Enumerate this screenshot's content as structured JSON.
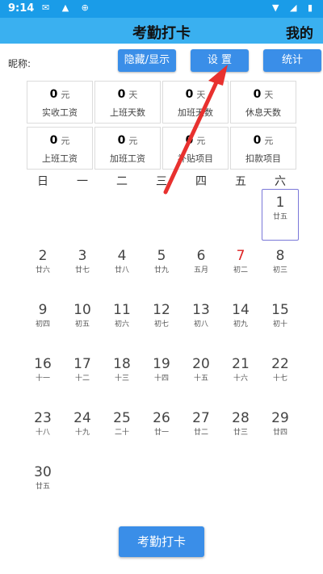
{
  "status": {
    "time": "9:14"
  },
  "header": {
    "title": "考勤打卡",
    "mine": "我的"
  },
  "nickname_label": "昵称:",
  "buttons": {
    "hide_show": "隐藏/显示",
    "settings": "设 置",
    "stats": "统计"
  },
  "stats": [
    {
      "value": "0",
      "unit": "元",
      "label": "实收工资"
    },
    {
      "value": "0",
      "unit": "天",
      "label": "上班天数"
    },
    {
      "value": "0",
      "unit": "天",
      "label": "加班天数"
    },
    {
      "value": "0",
      "unit": "天",
      "label": "休息天数"
    },
    {
      "value": "0",
      "unit": "元",
      "label": "上班工资"
    },
    {
      "value": "0",
      "unit": "元",
      "label": "加班工资"
    },
    {
      "value": "0",
      "unit": "元",
      "label": "补贴项目"
    },
    {
      "value": "0",
      "unit": "元",
      "label": "扣款项目"
    }
  ],
  "weekdays": [
    "日",
    "一",
    "二",
    "三",
    "四",
    "五",
    "六"
  ],
  "calendar": [
    {
      "day": "1",
      "sub": "廿五",
      "col": 6,
      "row": 0,
      "selected": true
    },
    {
      "day": "2",
      "sub": "廿六",
      "col": 0,
      "row": 1
    },
    {
      "day": "3",
      "sub": "廿七",
      "col": 1,
      "row": 1
    },
    {
      "day": "4",
      "sub": "廿八",
      "col": 2,
      "row": 1
    },
    {
      "day": "5",
      "sub": "廿九",
      "col": 3,
      "row": 1
    },
    {
      "day": "6",
      "sub": "五月",
      "col": 4,
      "row": 1
    },
    {
      "day": "7",
      "sub": "初二",
      "col": 5,
      "row": 1,
      "red": true
    },
    {
      "day": "8",
      "sub": "初三",
      "col": 6,
      "row": 1
    },
    {
      "day": "9",
      "sub": "初四",
      "col": 0,
      "row": 2
    },
    {
      "day": "10",
      "sub": "初五",
      "col": 1,
      "row": 2
    },
    {
      "day": "11",
      "sub": "初六",
      "col": 2,
      "row": 2
    },
    {
      "day": "12",
      "sub": "初七",
      "col": 3,
      "row": 2
    },
    {
      "day": "13",
      "sub": "初八",
      "col": 4,
      "row": 2
    },
    {
      "day": "14",
      "sub": "初九",
      "col": 5,
      "row": 2
    },
    {
      "day": "15",
      "sub": "初十",
      "col": 6,
      "row": 2
    },
    {
      "day": "16",
      "sub": "十一",
      "col": 0,
      "row": 3
    },
    {
      "day": "17",
      "sub": "十二",
      "col": 1,
      "row": 3
    },
    {
      "day": "18",
      "sub": "十三",
      "col": 2,
      "row": 3
    },
    {
      "day": "19",
      "sub": "十四",
      "col": 3,
      "row": 3
    },
    {
      "day": "20",
      "sub": "十五",
      "col": 4,
      "row": 3
    },
    {
      "day": "21",
      "sub": "十六",
      "col": 5,
      "row": 3
    },
    {
      "day": "22",
      "sub": "十七",
      "col": 6,
      "row": 3
    },
    {
      "day": "23",
      "sub": "十八",
      "col": 0,
      "row": 4
    },
    {
      "day": "24",
      "sub": "十九",
      "col": 1,
      "row": 4
    },
    {
      "day": "25",
      "sub": "二十",
      "col": 2,
      "row": 4
    },
    {
      "day": "26",
      "sub": "廿一",
      "col": 3,
      "row": 4
    },
    {
      "day": "27",
      "sub": "廿二",
      "col": 4,
      "row": 4
    },
    {
      "day": "28",
      "sub": "廿三",
      "col": 5,
      "row": 4
    },
    {
      "day": "29",
      "sub": "廿四",
      "col": 6,
      "row": 4
    },
    {
      "day": "30",
      "sub": "廿五",
      "col": 0,
      "row": 5
    }
  ],
  "checkin_button": "考勤打卡",
  "colors": {
    "accent": "#3a8ee8",
    "appbar": "#3ab0f0",
    "statusbar": "#1a9ce8",
    "arrow": "#e8312f",
    "today": "#d22222"
  }
}
